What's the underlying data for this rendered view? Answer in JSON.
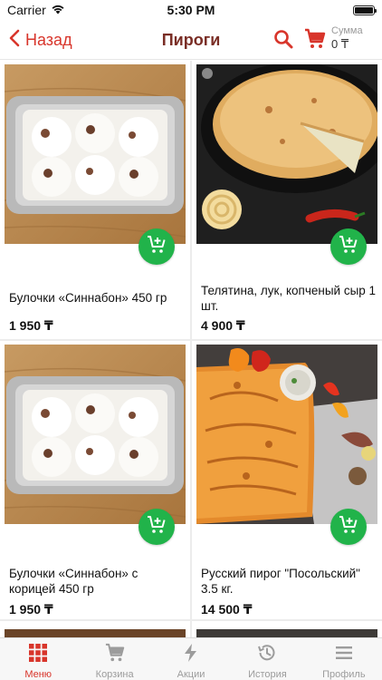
{
  "status_bar": {
    "carrier": "Carrier",
    "time": "5:30 PM"
  },
  "nav": {
    "back_label": "Назад",
    "title": "Пироги",
    "sum_label": "Сумма",
    "sum_value": "0 ₸"
  },
  "products": [
    {
      "name": "Булочки «Синнабон» 450 гр",
      "price": "1 950 ₸"
    },
    {
      "name": "Телятина, лук, копченый сыр 1 шт.",
      "price": "4 900 ₸"
    },
    {
      "name": "Булочки «Синнабон» с корицей 450 гр",
      "price": "1 950 ₸"
    },
    {
      "name": "Русский пирог \"Посольский\" 3.5 кг.",
      "price": "14 500 ₸"
    }
  ],
  "tabs": [
    {
      "label": "Меню",
      "icon": "grid-icon",
      "active": true
    },
    {
      "label": "Корзина",
      "icon": "cart-icon",
      "active": false
    },
    {
      "label": "Акции",
      "icon": "lightning-icon",
      "active": false
    },
    {
      "label": "История",
      "icon": "history-icon",
      "active": false
    },
    {
      "label": "Профиль",
      "icon": "menu-icon",
      "active": false
    }
  ],
  "colors": {
    "accent": "#d8352b",
    "title": "#7a2e26",
    "add_button": "#21b34a",
    "tab_inactive": "#9c9c9c"
  }
}
